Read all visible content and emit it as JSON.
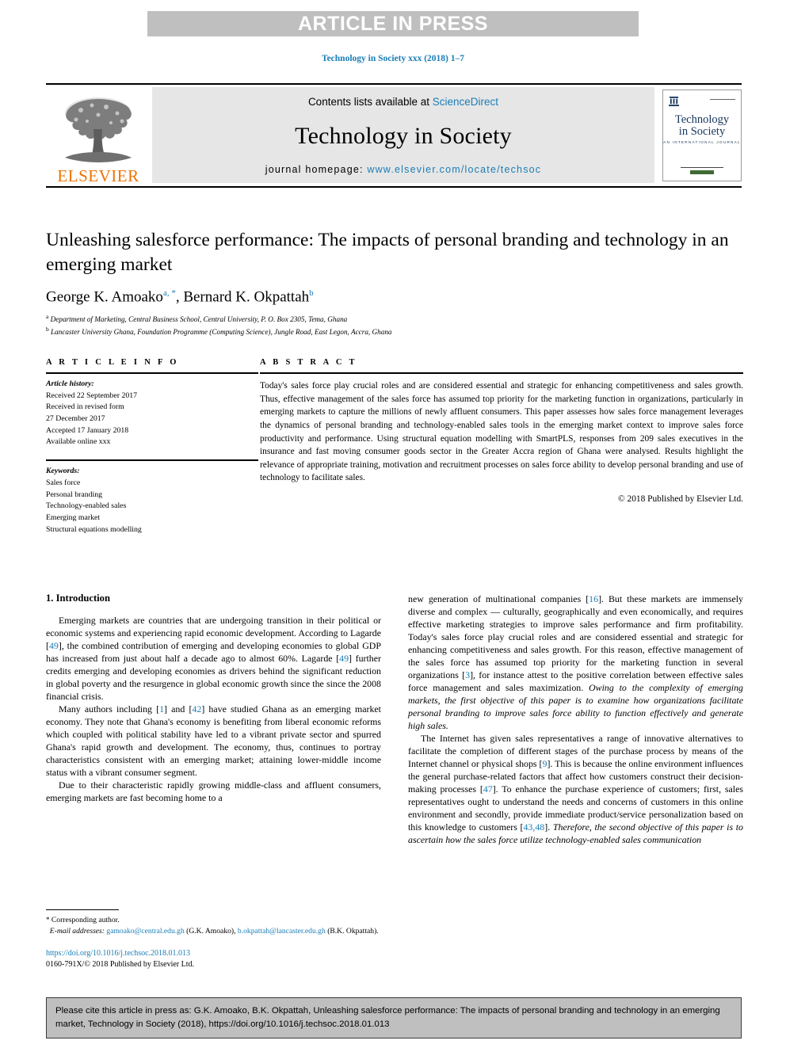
{
  "banner": {
    "text": "ARTICLE IN PRESS"
  },
  "running_head": {
    "text": "Technology in Society xxx (2018) 1–7"
  },
  "masthead": {
    "contents_prefix": "Contents lists available at ",
    "contents_link": "ScienceDirect",
    "journal_name": "Technology in Society",
    "homepage_prefix": "journal homepage: ",
    "homepage_url": "www.elsevier.com/locate/techsoc",
    "publisher": "ELSEVIER",
    "cover": {
      "line1": "Technology",
      "line2": "in Society",
      "subtitle": "AN INTERNATIONAL JOURNAL"
    }
  },
  "article": {
    "title": "Unleashing salesforce performance: The impacts of personal branding and technology in an emerging market",
    "authors": [
      {
        "name": "George K. Amoako",
        "marks": "a, *"
      },
      {
        "name": "Bernard K. Okpattah",
        "marks": "b"
      }
    ],
    "affiliations": [
      {
        "mark": "a",
        "text": "Department of Marketing, Central Business School, Central University, P. O. Box 2305, Tema, Ghana"
      },
      {
        "mark": "b",
        "text": "Lancaster University Ghana, Foundation Programme (Computing Science), Jungle Road, East Legon, Accra, Ghana"
      }
    ]
  },
  "info": {
    "heading": "A R T I C L E  I N F O",
    "history_label": "Article history:",
    "history": [
      "Received 22 September 2017",
      "Received in revised form",
      "27 December 2017",
      "Accepted 17 January 2018",
      "Available online xxx"
    ],
    "keywords_label": "Keywords:",
    "keywords": [
      "Sales force",
      "Personal branding",
      "Technology-enabled sales",
      "Emerging market",
      "Structural equations modelling"
    ]
  },
  "abstract": {
    "heading": "A B S T R A C T",
    "text": "Today's sales force play crucial roles and are considered essential and strategic for enhancing competitiveness and sales growth. Thus, effective management of the sales force has assumed top priority for the marketing function in organizations, particularly in emerging markets to capture the millions of newly affluent consumers. This paper assesses how sales force management leverages the dynamics of personal branding and technology-enabled sales tools in the emerging market context to improve sales force productivity and performance. Using structural equation modelling with SmartPLS, responses from 209 sales executives in the insurance and fast moving consumer goods sector in the Greater Accra region of Ghana were analysed. Results highlight the relevance of appropriate training, motivation and recruitment processes on sales force ability to develop personal branding and use of technology to facilitate sales.",
    "copyright": "© 2018 Published by Elsevier Ltd."
  },
  "body": {
    "section_title": "1. Introduction",
    "left_paragraphs": [
      {
        "parts": [
          {
            "t": "Emerging markets are countries that are undergoing transition in their political or economic systems and experiencing rapid economic development. According to Lagarde ["
          },
          {
            "t": "49",
            "style": "ref"
          },
          {
            "t": "], the combined contribution of emerging and developing economies to global GDP has increased from just about half a decade ago to almost 60%. Lagarde ["
          },
          {
            "t": "49",
            "style": "ref"
          },
          {
            "t": "] further credits emerging and developing economies as drivers behind the significant reduction in global poverty and the resurgence in global economic growth since the since the 2008 financial crisis."
          }
        ]
      },
      {
        "parts": [
          {
            "t": "Many authors including ["
          },
          {
            "t": "1",
            "style": "ref"
          },
          {
            "t": "] and ["
          },
          {
            "t": "42",
            "style": "ref"
          },
          {
            "t": "] have studied Ghana as an emerging market economy. They note that Ghana's economy is benefiting from liberal economic reforms which coupled with political stability have led to a vibrant private sector and spurred Ghana's rapid growth and development. The economy, thus, continues to portray characteristics consistent with an emerging market; attaining lower-middle income status with a vibrant consumer segment."
          }
        ]
      },
      {
        "parts": [
          {
            "t": "Due to their characteristic rapidly growing middle-class and affluent consumers, emerging markets are fast becoming home to a"
          }
        ]
      }
    ],
    "right_paragraphs": [
      {
        "noindent": true,
        "parts": [
          {
            "t": "new generation of multinational companies ["
          },
          {
            "t": "16",
            "style": "ref"
          },
          {
            "t": "]. But these markets are immensely diverse and complex — culturally, geographically and even economically, and requires effective marketing strategies to improve sales performance and firm profitability. Today's sales force play crucial roles and are considered essential and strategic for enhancing competitiveness and sales growth. For this reason, effective management of the sales force has assumed top priority for the marketing function in several organizations ["
          },
          {
            "t": "3",
            "style": "ref"
          },
          {
            "t": "], for instance attest to the positive correlation between effective sales force management and sales maximization. "
          },
          {
            "t": "Owing to the complexity of emerging markets, the first objective of this paper is to examine how organizations facilitate personal branding to improve sales force ability to function effectively and generate high sales.",
            "style": "ital"
          }
        ]
      },
      {
        "parts": [
          {
            "t": "The Internet has given sales representatives a range of innovative alternatives to facilitate the completion of different stages of the purchase process by means of the Internet channel or physical shops ["
          },
          {
            "t": "9",
            "style": "ref"
          },
          {
            "t": "]. This is because the online environment influences the general purchase-related factors that affect how customers construct their decision-making processes ["
          },
          {
            "t": "47",
            "style": "ref"
          },
          {
            "t": "]. To enhance the purchase experience of customers; first, sales representatives ought to understand the needs and concerns of customers in this online environment and secondly, provide immediate product/service personalization based on this knowledge to customers ["
          },
          {
            "t": "43,48",
            "style": "ref"
          },
          {
            "t": "]. "
          },
          {
            "t": "Therefore, the second objective of this paper is to ascertain how the sales force utilize technology-enabled sales communication",
            "style": "ital"
          }
        ]
      }
    ]
  },
  "footnote": {
    "corresponding": "Corresponding author.",
    "email_label": "E-mail addresses:",
    "emails": [
      {
        "address": "gamoako@central.edu.gh",
        "owner": "(G.K. Amoako)"
      },
      {
        "address": "b.okpattah@lancaster.edu.gh",
        "owner": "(B.K. Okpattah)"
      }
    ],
    "doi": "https://doi.org/10.1016/j.techsoc.2018.01.013",
    "issn_line": "0160-791X/© 2018 Published by Elsevier Ltd."
  },
  "citation": {
    "text": "Please cite this article in press as: G.K. Amoako, B.K. Okpattah, Unleashing salesforce performance: The impacts of personal branding and technology in an emerging market, Technology in Society (2018), https://doi.org/10.1016/j.techsoc.2018.01.013"
  },
  "colors": {
    "link": "#1a7db6",
    "banner_bg": "#bfbfbf",
    "elsevier_orange": "#ee7203",
    "masthead_bg": "#e6e6e6",
    "cover_navy": "#16365c"
  }
}
